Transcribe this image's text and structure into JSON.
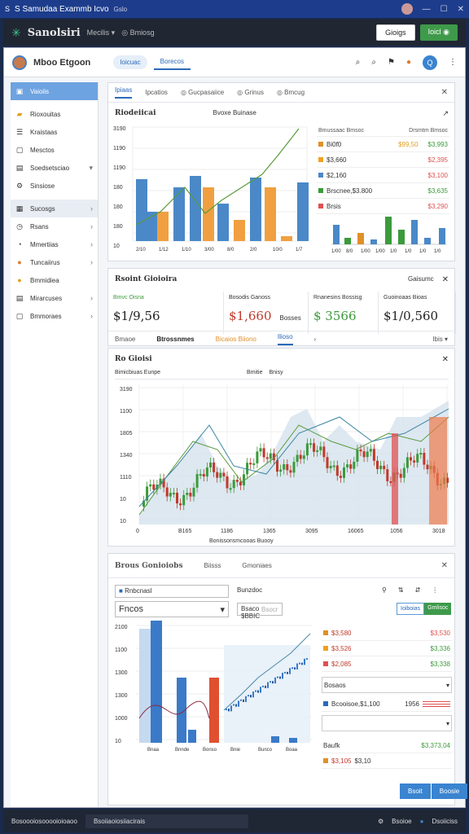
{
  "window": {
    "title": "S Samudaa Exammb Icvo",
    "tab": "Gslo"
  },
  "appbar": {
    "title": "Sanolsiri",
    "menu": "Mecilis",
    "user": "Bmiosg",
    "btn1": "Gioigs",
    "btn2": "Ioicl"
  },
  "header": {
    "title": "Mboo Etgoon",
    "tabs": [
      "Ioicuac",
      "Borecos"
    ]
  },
  "sidebar": {
    "items": [
      "Vaioiis",
      "Rioxouitas",
      "Kraistaas",
      "Mesctos",
      "Soedsetsciao",
      "Sinsiose",
      "Sucosgs",
      "Rsans",
      "Mmertiias",
      "Tuncaiirus",
      "Bmmidiea",
      "Mirarcuses",
      "Bmmoraes"
    ]
  },
  "panel1": {
    "tabs": [
      "Ipiaas",
      "Ipcatios",
      "Gucpasaiice",
      "Grinus",
      "Bmcug"
    ],
    "title": "Riodeiicai",
    "subtitle": "Bvoxe Buinase",
    "list_header": [
      "Bmussaac Bmsoc",
      "Drsmtm Bmsoc"
    ],
    "rows": [
      {
        "label": "Bi0f0",
        "v1": "$99,50",
        "v2": "$3,993",
        "c1": "#e0a020",
        "c2": "#3b9a3b",
        "dot": "#e0902a"
      },
      {
        "label": "$3,660",
        "v1": "",
        "v2": "$2,395",
        "c1": "#e07a2a",
        "c2": "#e05050",
        "dot": "#f0a020"
      },
      {
        "label": "$2,160",
        "v1": "",
        "v2": "$3,100",
        "c1": "#e0a020",
        "c2": "#e05050",
        "dot": "#4a88c8"
      },
      {
        "label": "Brscnee,$3.800",
        "v1": "",
        "v2": "$3,635",
        "c1": "#333",
        "c2": "#3b9a3b",
        "dot": "#3b9a3b"
      },
      {
        "label": "Brsis",
        "v1": "",
        "v2": "$3,290",
        "c1": "#333",
        "c2": "#e05050",
        "dot": "#e05050"
      }
    ]
  },
  "panel2": {
    "title": "Rsoint Gioioira",
    "action": "Gaisumc",
    "stats": [
      {
        "label": "Bmvc Oisna",
        "value": "$1/9,56",
        "sub": "",
        "color": "#222",
        "lc": "#3b9a3b"
      },
      {
        "label": "Bosodis Ganoss",
        "value": "$1,660",
        "sub": "Bosses",
        "color": "#c0392b",
        "lc": "#333"
      },
      {
        "label": "Rnanesins Bossisg",
        "value": "$ 3566",
        "sub": "",
        "color": "#3b9a3b",
        "lc": "#333"
      },
      {
        "label": "Guoinoaas Bioas",
        "value": "$1/0,560",
        "sub": "",
        "color": "#222",
        "lc": "#333"
      }
    ],
    "tabs": [
      "Bmaoe",
      "Btrossnmes",
      "Bicaios Biiono",
      "Ilioso",
      "Ibis"
    ]
  },
  "panel3": {
    "title": "Ro Gioisi",
    "sub1": "Bimicbiuas Eunpe",
    "sub2": "Bmitie",
    "sub3": "Bnisy",
    "xlabel": "Bonissonsmcooas Buooy",
    "xticks": [
      "0",
      "B165",
      "1186",
      "1365",
      "3095",
      "16065",
      "1056",
      "3018"
    ],
    "yticks": [
      "3190",
      "1100",
      "1805",
      "1340",
      "1110",
      "10",
      "10"
    ]
  },
  "panel4": {
    "tabs": [
      "Brous Gonioiobs",
      "Biisss",
      "Gmoniaes"
    ],
    "select_label": "Rnbcnasl",
    "select_value": "Fncos",
    "input_label": "Bunzdoc",
    "input2": "Bsocr",
    "input_value": "Bsaco $BBIC",
    "btn1": "Ioiboias",
    "btn2": "Gmlisoc",
    "ticks": [
      "2100",
      "1100",
      "1300",
      "1300",
      "1000",
      "10"
    ],
    "xticks": [
      "Bnaa",
      "Bnnde",
      "Bonso",
      "Bnie",
      "Bunco",
      "Boaa"
    ],
    "rows": [
      {
        "label": "$3,580",
        "val": "$3,530",
        "c": "#e05050",
        "dot": "#e0902a"
      },
      {
        "label": "$3,526",
        "val": "$3,336",
        "c": "#3b9a3b",
        "dot": "#f0a020"
      },
      {
        "label": "$2,085",
        "val": "$3,338",
        "c": "#3b9a3b",
        "dot": "#e05050"
      }
    ],
    "row2label": "Bosaos",
    "row3label": "Bcooisoe,$1,100",
    "row3val": "1956",
    "row4label": "Baufk",
    "row4val": "$3,373,04",
    "row5label": "$3,105",
    "row5val": "$3,10",
    "save": "Bsoit",
    "cancel": "Boosie"
  },
  "statusbar": {
    "left": "Bosoooiosooooioioaoo",
    "mid": "Bsoiiaoiosiiacirais",
    "right1": "Bsoioe",
    "right2": "Dsoiiciss"
  }
}
